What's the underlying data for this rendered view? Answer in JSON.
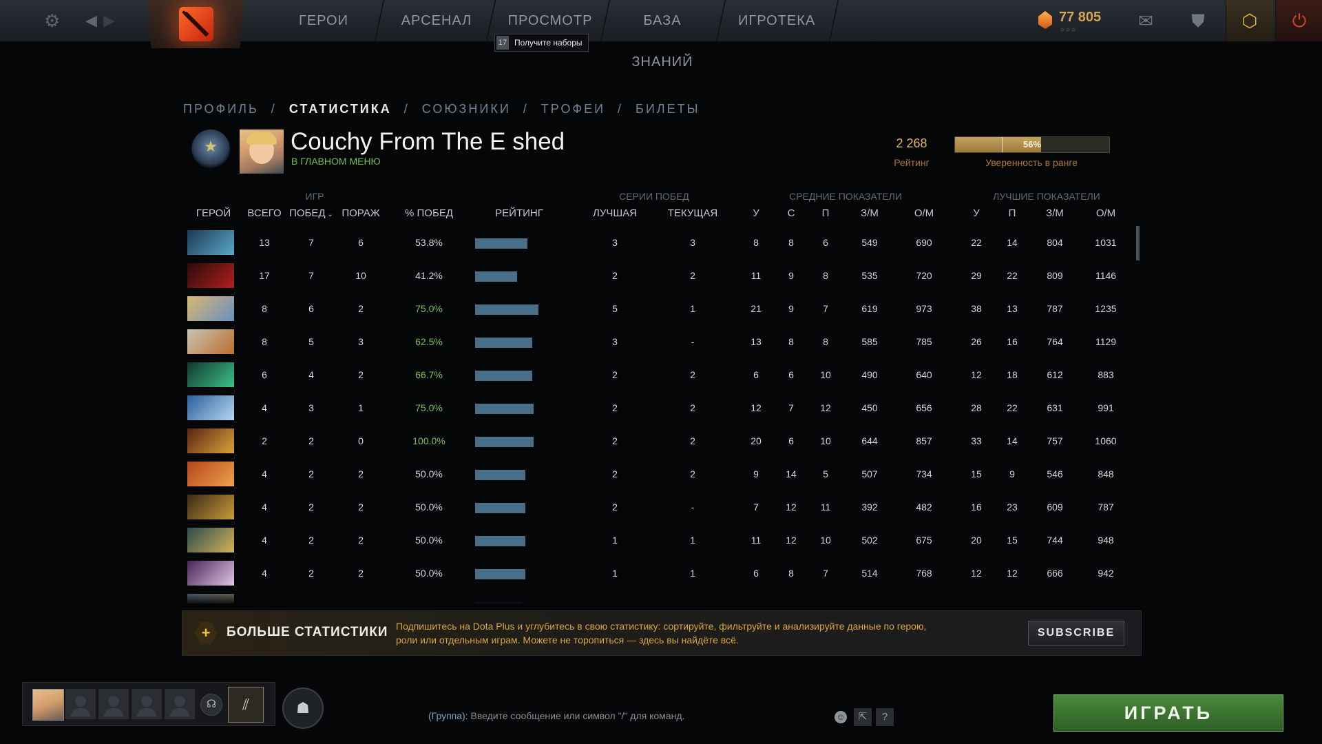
{
  "topbar": {
    "nav": [
      "ГЕРОИ",
      "АРСЕНАЛ",
      "ПРОСМОТР",
      "БАЗА ЗНАНИЙ",
      "ИГРОТЕКА"
    ],
    "tooltip": {
      "count": "17",
      "text": "Получите наборы"
    },
    "currency": "77 805",
    "icons": {
      "settings": "gear-icon",
      "back": "back-arrow-icon",
      "forward": "forward-arrow-icon",
      "mail": "mail-icon",
      "armory": "armory-icon",
      "plus": "dota-plus-icon",
      "power": "power-icon"
    }
  },
  "breadcrumb": [
    "ПРОФИЛЬ",
    "СТАТИСТИКА",
    "СОЮЗНИКИ",
    "ТРОФЕИ",
    "БИЛЕТЫ"
  ],
  "profile": {
    "name": "Couchy From The E shed",
    "status": "В ГЛАВНОМ МЕНЮ",
    "rating": "2 268",
    "rating_label": "Рейтинг",
    "confidence": "56%",
    "confidence_value": 0.56,
    "confidence_label": "Уверенность в ранге"
  },
  "table": {
    "groups": {
      "games": "ИГР",
      "streaks": "СЕРИИ ПОБЕД",
      "avg": "СРЕДНИЕ ПОКАЗАТЕЛИ",
      "best": "ЛУЧШИЕ ПОКАЗАТЕЛИ"
    },
    "columns": {
      "hero": "ГЕРОЙ",
      "total": "ВСЕГО",
      "wins": "ПОБЕД",
      "losses": "ПОРАЖ",
      "winrate": "% ПОБЕД",
      "rating": "РЕЙТИНГ",
      "best_streak": "ЛУЧШАЯ",
      "cur_streak": "ТЕКУЩАЯ",
      "k": "У",
      "d": "С",
      "a": "П",
      "gpm": "З/М",
      "xpm": "О/М",
      "best_k": "У",
      "best_a": "П",
      "best_gpm": "З/М",
      "best_xpm": "О/М"
    },
    "rows": [
      {
        "total": "13",
        "wins": "7",
        "losses": "6",
        "winrate": "53.8%",
        "bar": 0.83,
        "best_streak": "3",
        "cur_streak": "3",
        "k": "8",
        "d": "8",
        "a": "6",
        "gpm": "549",
        "xpm": "690",
        "best_k": "22",
        "best_a": "14",
        "best_gpm": "804",
        "best_xpm": "1031",
        "c1": "#1c3a55",
        "c2": "#5aa7c9"
      },
      {
        "total": "17",
        "wins": "7",
        "losses": "10",
        "winrate": "41.2%",
        "bar": 0.66,
        "best_streak": "2",
        "cur_streak": "2",
        "k": "11",
        "d": "9",
        "a": "8",
        "gpm": "535",
        "xpm": "720",
        "best_k": "29",
        "best_a": "22",
        "best_gpm": "809",
        "best_xpm": "1146",
        "c1": "#2a0b0b",
        "c2": "#b0201d"
      },
      {
        "total": "8",
        "wins": "6",
        "losses": "2",
        "winrate": "75.0%",
        "bar": 1.0,
        "best_streak": "5",
        "cur_streak": "1",
        "k": "21",
        "d": "9",
        "a": "7",
        "gpm": "619",
        "xpm": "973",
        "best_k": "38",
        "best_a": "13",
        "best_gpm": "787",
        "best_xpm": "1235",
        "c1": "#d8b870",
        "c2": "#6a8fc0"
      },
      {
        "total": "8",
        "wins": "5",
        "losses": "3",
        "winrate": "62.5%",
        "bar": 0.9,
        "best_streak": "3",
        "cur_streak": "-",
        "k": "13",
        "d": "8",
        "a": "8",
        "gpm": "585",
        "xpm": "785",
        "best_k": "26",
        "best_a": "16",
        "best_gpm": "764",
        "best_xpm": "1129",
        "c1": "#c9c3b4",
        "c2": "#b9702e"
      },
      {
        "total": "6",
        "wins": "4",
        "losses": "2",
        "winrate": "66.7%",
        "bar": 0.9,
        "best_streak": "2",
        "cur_streak": "2",
        "k": "6",
        "d": "6",
        "a": "10",
        "gpm": "490",
        "xpm": "640",
        "best_k": "12",
        "best_a": "18",
        "best_gpm": "612",
        "best_xpm": "883",
        "c1": "#0f3a2c",
        "c2": "#3fbf8a"
      },
      {
        "total": "4",
        "wins": "3",
        "losses": "1",
        "winrate": "75.0%",
        "bar": 0.92,
        "best_streak": "2",
        "cur_streak": "2",
        "k": "12",
        "d": "7",
        "a": "12",
        "gpm": "450",
        "xpm": "656",
        "best_k": "28",
        "best_a": "22",
        "best_gpm": "631",
        "best_xpm": "991",
        "c1": "#2b5e9c",
        "c2": "#b7d6f0"
      },
      {
        "total": "2",
        "wins": "2",
        "losses": "0",
        "winrate": "100.0%",
        "bar": 0.92,
        "best_streak": "2",
        "cur_streak": "2",
        "k": "20",
        "d": "6",
        "a": "10",
        "gpm": "644",
        "xpm": "857",
        "best_k": "33",
        "best_a": "14",
        "best_gpm": "757",
        "best_xpm": "1060",
        "c1": "#5a2412",
        "c2": "#d8a23c"
      },
      {
        "total": "4",
        "wins": "2",
        "losses": "2",
        "winrate": "50.0%",
        "bar": 0.79,
        "best_streak": "2",
        "cur_streak": "2",
        "k": "9",
        "d": "14",
        "a": "5",
        "gpm": "507",
        "xpm": "734",
        "best_k": "15",
        "best_a": "9",
        "best_gpm": "546",
        "best_xpm": "848",
        "c1": "#b3461c",
        "c2": "#f0a24a"
      },
      {
        "total": "4",
        "wins": "2",
        "losses": "2",
        "winrate": "50.0%",
        "bar": 0.79,
        "best_streak": "2",
        "cur_streak": "-",
        "k": "7",
        "d": "12",
        "a": "11",
        "gpm": "392",
        "xpm": "482",
        "best_k": "16",
        "best_a": "23",
        "best_gpm": "609",
        "best_xpm": "787",
        "c1": "#3a2a16",
        "c2": "#c99a3a"
      },
      {
        "total": "4",
        "wins": "2",
        "losses": "2",
        "winrate": "50.0%",
        "bar": 0.79,
        "best_streak": "1",
        "cur_streak": "1",
        "k": "11",
        "d": "12",
        "a": "10",
        "gpm": "502",
        "xpm": "675",
        "best_k": "20",
        "best_a": "15",
        "best_gpm": "744",
        "best_xpm": "948",
        "c1": "#2f4a4a",
        "c2": "#d2b35a"
      },
      {
        "total": "4",
        "wins": "2",
        "losses": "2",
        "winrate": "50.0%",
        "bar": 0.79,
        "best_streak": "1",
        "cur_streak": "1",
        "k": "6",
        "d": "8",
        "a": "7",
        "gpm": "514",
        "xpm": "768",
        "best_k": "12",
        "best_a": "12",
        "best_gpm": "666",
        "best_xpm": "942",
        "c1": "#4a2456",
        "c2": "#e0c6e6"
      }
    ]
  },
  "plus_banner": {
    "title": "БОЛЬШЕ СТАТИСТИКИ",
    "description": "Подпишитесь на Dota Plus и углубитесь в свою статистику: сортируйте, фильтруйте и анализируйте данные по герою, роли или отдельным играм. Можете не торопиться — здесь вы найдёте всё.",
    "button": "SUBSCRIBE"
  },
  "bottom": {
    "chat_group": "(Группа):",
    "chat_placeholder": "Введите сообщение или символ \"/\" для команд.",
    "play": "ИГРАТЬ"
  }
}
